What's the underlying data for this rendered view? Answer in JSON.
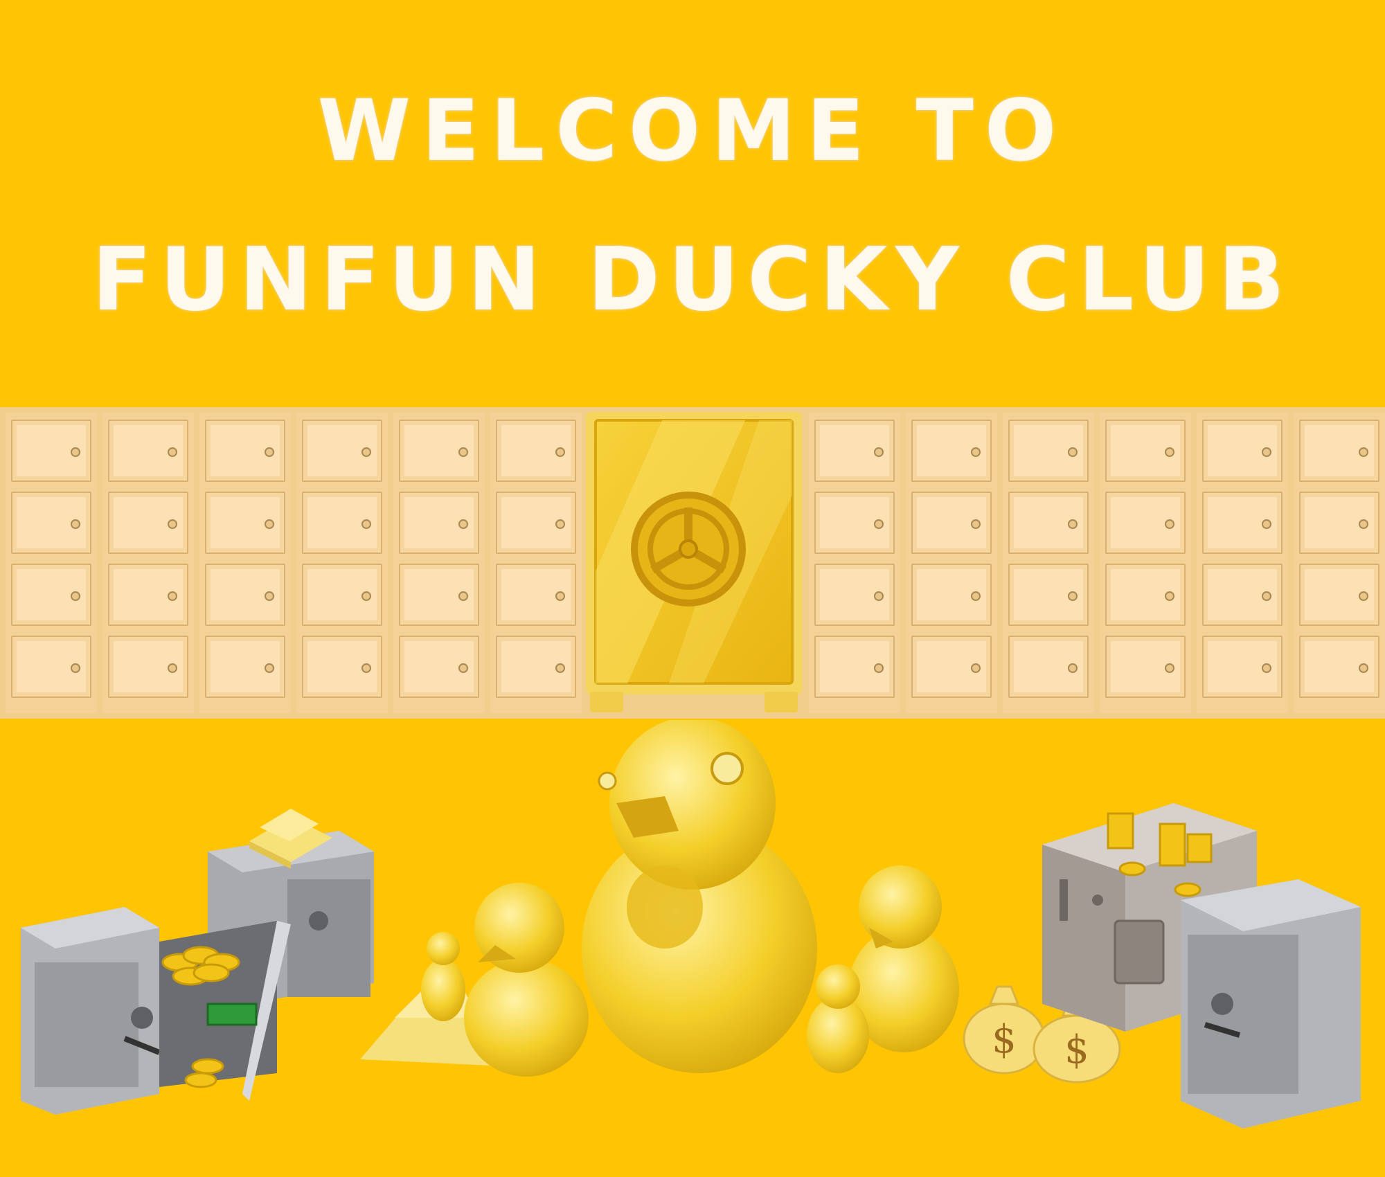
{
  "header": {
    "line1": "WELCOME TO",
    "line2": "FUNFUN DUCKY CLUB"
  },
  "colors": {
    "background": "#FFC505",
    "title_text": "#FFF8EC",
    "locker": "#FCE1B4",
    "vault_gold": "#F2C21A"
  },
  "icons": {
    "vault": "gold-vault-icon",
    "duck": "golden-duck-icon",
    "safe": "steel-safe-icon",
    "money_bag": "money-bag-icon",
    "gold_bars": "gold-bars-icon",
    "coins": "gold-coins-icon"
  },
  "money_bag_symbol": "$"
}
